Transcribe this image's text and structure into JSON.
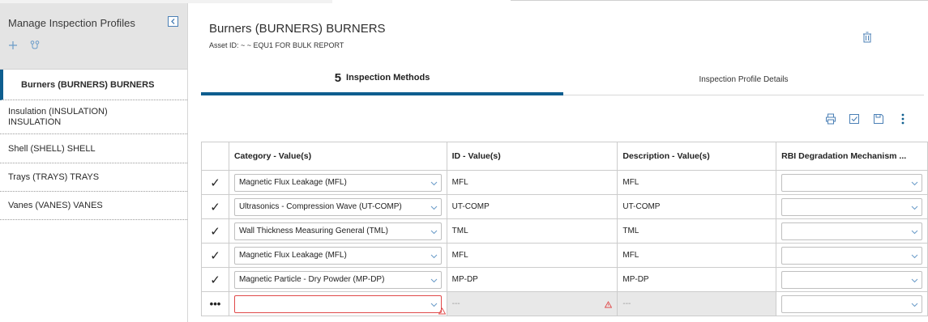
{
  "sidebar": {
    "title": "Manage Inspection Profiles",
    "items": [
      {
        "label": "Burners (BURNERS) BURNERS"
      },
      {
        "label": "Insulation (INSULATION) INSULATION"
      },
      {
        "label": "Shell (SHELL) SHELL"
      },
      {
        "label": "Trays (TRAYS) TRAYS"
      },
      {
        "label": "Vanes (VANES) VANES"
      }
    ]
  },
  "header": {
    "title": "Burners (BURNERS) BURNERS",
    "asset_id": "Asset ID: ~ ~ EQU1 FOR BULK REPORT"
  },
  "tabs": [
    {
      "count": "5",
      "label": "Inspection Methods"
    },
    {
      "label": "Inspection Profile Details"
    }
  ],
  "grid": {
    "columns": [
      "Category - Value(s)",
      "ID - Value(s)",
      "Description - Value(s)",
      "RBI Degradation Mechanism ..."
    ],
    "rows": [
      {
        "marker": "✓",
        "category": "Magnetic Flux Leakage (MFL)",
        "id": "MFL",
        "description": "MFL"
      },
      {
        "marker": "✓",
        "category": "Ultrasonics - Compression Wave (UT-COMP)",
        "id": "UT-COMP",
        "description": "UT-COMP"
      },
      {
        "marker": "✓",
        "category": "Wall Thickness Measuring General (TML)",
        "id": "TML",
        "description": "TML"
      },
      {
        "marker": "✓",
        "category": "Magnetic Flux Leakage (MFL)",
        "id": "MFL",
        "description": "MFL"
      },
      {
        "marker": "✓",
        "category": "Magnetic Particle - Dry Powder (MP-DP)",
        "id": "MP-DP",
        "description": "MP-DP"
      }
    ],
    "new_row": {
      "marker": "•••",
      "id": "---",
      "description": "---"
    }
  },
  "colors": {
    "accent": "#0e5e8f",
    "icon": "#4a7fb5",
    "error": "#e04a4a"
  },
  "icons": [
    "collapse-icon",
    "add-icon",
    "share-icon",
    "trash-icon",
    "print-icon",
    "check-square-icon",
    "save-icon",
    "more-vertical-icon",
    "chevron-down-icon",
    "warning-icon"
  ]
}
